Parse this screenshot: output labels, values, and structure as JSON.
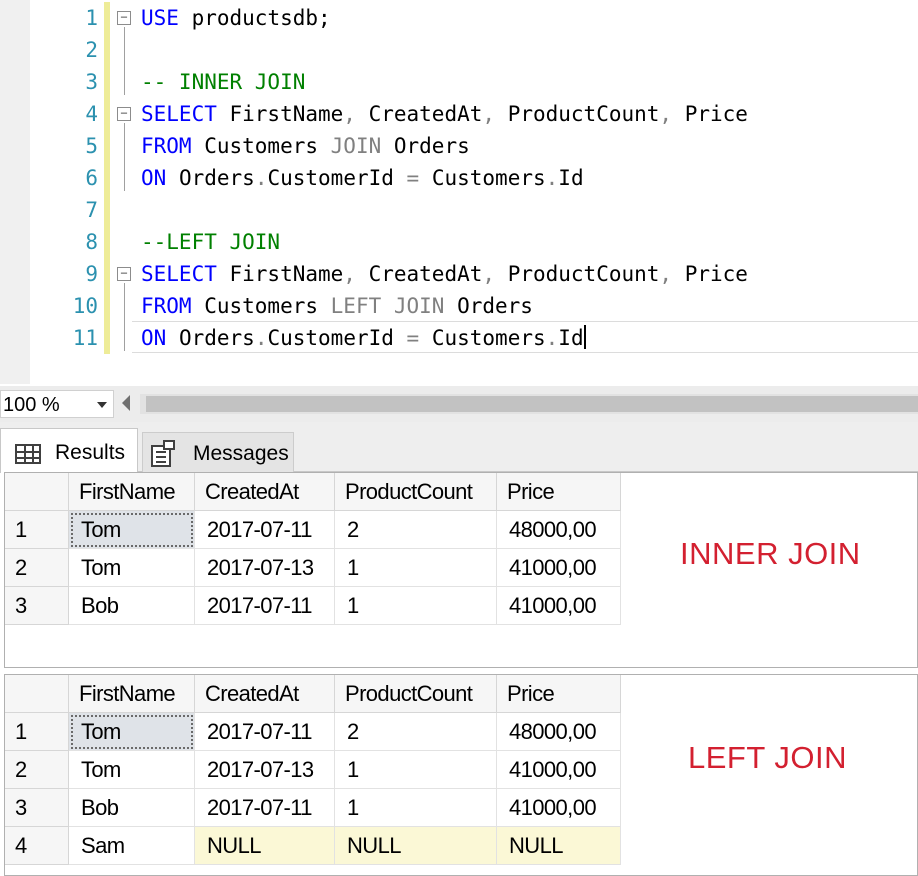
{
  "editor": {
    "lines": [
      {
        "num": "1",
        "parts": [
          {
            "t": "USE",
            "c": "kw"
          },
          {
            "t": " productsdb;",
            "c": "pl"
          }
        ]
      },
      {
        "num": "2",
        "parts": []
      },
      {
        "num": "3",
        "parts": [
          {
            "t": "-- INNER JOIN",
            "c": "cm"
          }
        ]
      },
      {
        "num": "4",
        "parts": [
          {
            "t": "SELECT",
            "c": "kw"
          },
          {
            "t": " FirstName",
            "c": "pl"
          },
          {
            "t": ",",
            "c": "gr"
          },
          {
            "t": " CreatedAt",
            "c": "pl"
          },
          {
            "t": ",",
            "c": "gr"
          },
          {
            "t": " ProductCount",
            "c": "pl"
          },
          {
            "t": ",",
            "c": "gr"
          },
          {
            "t": " Price",
            "c": "pl"
          }
        ]
      },
      {
        "num": "5",
        "parts": [
          {
            "t": "FROM",
            "c": "kw"
          },
          {
            "t": " Customers ",
            "c": "pl"
          },
          {
            "t": "JOIN",
            "c": "gr"
          },
          {
            "t": " Orders",
            "c": "pl"
          }
        ]
      },
      {
        "num": "6",
        "parts": [
          {
            "t": "ON",
            "c": "kw"
          },
          {
            "t": " Orders",
            "c": "pl"
          },
          {
            "t": ".",
            "c": "gr"
          },
          {
            "t": "CustomerId ",
            "c": "pl"
          },
          {
            "t": "=",
            "c": "gr"
          },
          {
            "t": " Customers",
            "c": "pl"
          },
          {
            "t": ".",
            "c": "gr"
          },
          {
            "t": "Id",
            "c": "pl"
          }
        ]
      },
      {
        "num": "7",
        "parts": []
      },
      {
        "num": "8",
        "parts": [
          {
            "t": "--LEFT JOIN",
            "c": "cm"
          }
        ]
      },
      {
        "num": "9",
        "parts": [
          {
            "t": "SELECT",
            "c": "kw"
          },
          {
            "t": " FirstName",
            "c": "pl"
          },
          {
            "t": ",",
            "c": "gr"
          },
          {
            "t": " CreatedAt",
            "c": "pl"
          },
          {
            "t": ",",
            "c": "gr"
          },
          {
            "t": " ProductCount",
            "c": "pl"
          },
          {
            "t": ",",
            "c": "gr"
          },
          {
            "t": " Price",
            "c": "pl"
          }
        ]
      },
      {
        "num": "10",
        "parts": [
          {
            "t": "FROM",
            "c": "kw"
          },
          {
            "t": " Customers ",
            "c": "pl"
          },
          {
            "t": "LEFT JOIN",
            "c": "gr"
          },
          {
            "t": " Orders",
            "c": "pl"
          }
        ]
      },
      {
        "num": "11",
        "parts": [
          {
            "t": "ON",
            "c": "kw"
          },
          {
            "t": " Orders",
            "c": "pl"
          },
          {
            "t": ".",
            "c": "gr"
          },
          {
            "t": "CustomerId ",
            "c": "pl"
          },
          {
            "t": "=",
            "c": "gr"
          },
          {
            "t": " Customers",
            "c": "pl"
          },
          {
            "t": ".",
            "c": "gr"
          },
          {
            "t": "Id",
            "c": "pl"
          }
        ]
      }
    ],
    "fold_lines": [
      "1",
      "4",
      "9"
    ],
    "current_line": "11"
  },
  "zoom": {
    "value": "100 %"
  },
  "tabs": {
    "results": "Results",
    "messages": "Messages"
  },
  "grids": [
    {
      "label": "INNER JOIN",
      "columns": [
        "FirstName",
        "CreatedAt",
        "ProductCount",
        "Price"
      ],
      "rows": [
        {
          "n": "1",
          "cells": [
            "Tom",
            "2017-07-11",
            "2",
            "48000,00"
          ]
        },
        {
          "n": "2",
          "cells": [
            "Tom",
            "2017-07-13",
            "1",
            "41000,00"
          ]
        },
        {
          "n": "3",
          "cells": [
            "Bob",
            "2017-07-11",
            "1",
            "41000,00"
          ]
        }
      ]
    },
    {
      "label": "LEFT JOIN",
      "columns": [
        "FirstName",
        "CreatedAt",
        "ProductCount",
        "Price"
      ],
      "rows": [
        {
          "n": "1",
          "cells": [
            "Tom",
            "2017-07-11",
            "2",
            "48000,00"
          ]
        },
        {
          "n": "2",
          "cells": [
            "Tom",
            "2017-07-13",
            "1",
            "41000,00"
          ]
        },
        {
          "n": "3",
          "cells": [
            "Bob",
            "2017-07-11",
            "1",
            "41000,00"
          ]
        },
        {
          "n": "4",
          "cells": [
            "Sam",
            "NULL",
            "NULL",
            "NULL"
          ]
        }
      ]
    }
  ],
  "colors": {
    "keyword": "#0000ff",
    "comment": "#008000",
    "operator": "#808080",
    "line_number": "#2b91af",
    "join_label": "#d32030",
    "null_cell": "#fbf8d6"
  }
}
